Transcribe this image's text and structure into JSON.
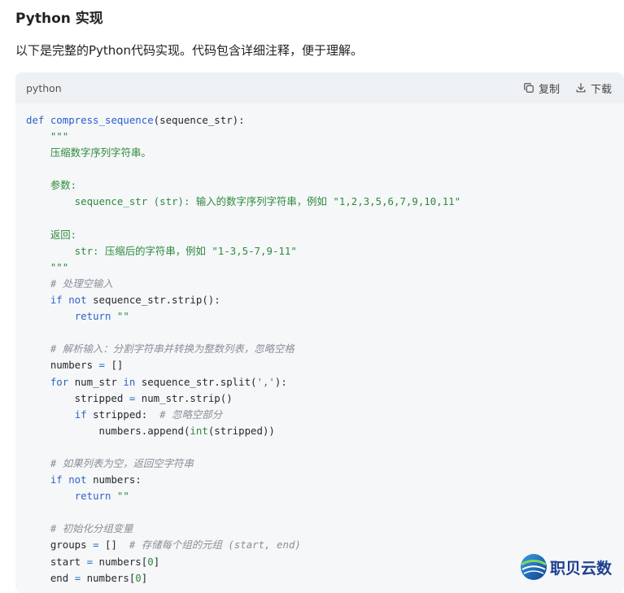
{
  "heading": "Python 实现",
  "intro": "以下是完整的Python代码实现。代码包含详细注释，便于理解。",
  "code_block": {
    "language": "python",
    "copy_label": "复制",
    "download_label": "下载",
    "lines": [
      [
        {
          "t": "def ",
          "c": "kw-b"
        },
        {
          "t": "compress_sequence",
          "c": "fn"
        },
        {
          "t": "(sequence_str):",
          "c": ""
        }
      ],
      [
        {
          "t": "    \"\"\"",
          "c": "str"
        }
      ],
      [
        {
          "t": "    压缩数字序列字符串。",
          "c": "str"
        }
      ],
      [],
      [
        {
          "t": "    参数:",
          "c": "str"
        }
      ],
      [
        {
          "t": "        sequence_str (str): 输入的数字序列字符串，例如 \"1,2,3,5,6,7,9,10,11\"",
          "c": "str"
        }
      ],
      [],
      [
        {
          "t": "    返回:",
          "c": "str"
        }
      ],
      [
        {
          "t": "        str: 压缩后的字符串，例如 \"1-3,5-7,9-11\"",
          "c": "str"
        }
      ],
      [
        {
          "t": "    \"\"\"",
          "c": "str"
        }
      ],
      [
        {
          "t": "    # 处理空输入",
          "c": "cm"
        }
      ],
      [
        {
          "t": "    ",
          "c": ""
        },
        {
          "t": "if not",
          "c": "kw-b"
        },
        {
          "t": " sequence_str.strip():",
          "c": ""
        }
      ],
      [
        {
          "t": "        ",
          "c": ""
        },
        {
          "t": "return",
          "c": "kw-b"
        },
        {
          "t": " ",
          "c": ""
        },
        {
          "t": "\"\"",
          "c": "str"
        }
      ],
      [],
      [
        {
          "t": "    # 解析输入：分割字符串并转换为整数列表，忽略空格",
          "c": "cm"
        }
      ],
      [
        {
          "t": "    numbers ",
          "c": ""
        },
        {
          "t": "=",
          "c": "op"
        },
        {
          "t": " []",
          "c": ""
        }
      ],
      [
        {
          "t": "    ",
          "c": ""
        },
        {
          "t": "for",
          "c": "kw-b"
        },
        {
          "t": " num_str ",
          "c": ""
        },
        {
          "t": "in",
          "c": "kw-b"
        },
        {
          "t": " sequence_str.split(",
          "c": ""
        },
        {
          "t": "','",
          "c": "str"
        },
        {
          "t": "):",
          "c": ""
        }
      ],
      [
        {
          "t": "        stripped ",
          "c": ""
        },
        {
          "t": "=",
          "c": "op"
        },
        {
          "t": " num_str.strip()",
          "c": ""
        }
      ],
      [
        {
          "t": "        ",
          "c": ""
        },
        {
          "t": "if",
          "c": "kw-b"
        },
        {
          "t": " stripped:  ",
          "c": ""
        },
        {
          "t": "# 忽略空部分",
          "c": "cm"
        }
      ],
      [
        {
          "t": "            numbers.append(",
          "c": ""
        },
        {
          "t": "int",
          "c": "bi"
        },
        {
          "t": "(stripped))",
          "c": ""
        }
      ],
      [],
      [
        {
          "t": "    # 如果列表为空，返回空字符串",
          "c": "cm"
        }
      ],
      [
        {
          "t": "    ",
          "c": ""
        },
        {
          "t": "if not",
          "c": "kw-b"
        },
        {
          "t": " numbers:",
          "c": ""
        }
      ],
      [
        {
          "t": "        ",
          "c": ""
        },
        {
          "t": "return",
          "c": "kw-b"
        },
        {
          "t": " ",
          "c": ""
        },
        {
          "t": "\"\"",
          "c": "str"
        }
      ],
      [],
      [
        {
          "t": "    # 初始化分组变量",
          "c": "cm"
        }
      ],
      [
        {
          "t": "    groups ",
          "c": ""
        },
        {
          "t": "=",
          "c": "op"
        },
        {
          "t": " []  ",
          "c": ""
        },
        {
          "t": "# 存储每个组的元组 (start, end)",
          "c": "cm"
        }
      ],
      [
        {
          "t": "    start ",
          "c": ""
        },
        {
          "t": "=",
          "c": "op"
        },
        {
          "t": " numbers[",
          "c": ""
        },
        {
          "t": "0",
          "c": "num"
        },
        {
          "t": "]",
          "c": ""
        }
      ],
      [
        {
          "t": "    end ",
          "c": ""
        },
        {
          "t": "=",
          "c": "op"
        },
        {
          "t": " numbers[",
          "c": ""
        },
        {
          "t": "0",
          "c": "num"
        },
        {
          "t": "]",
          "c": ""
        }
      ]
    ]
  },
  "watermark": {
    "text": "职贝云数",
    "brand_color": "#1d3f8f"
  }
}
